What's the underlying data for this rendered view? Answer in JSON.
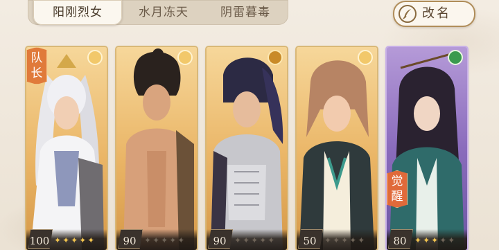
{
  "tabs": [
    {
      "label": "阳刚烈女",
      "active": true
    },
    {
      "label": "水月冻天",
      "active": false
    },
    {
      "label": "阴雷暮毒",
      "active": false
    }
  ],
  "rename_button": {
    "label": "改名",
    "icon": "quill-icon"
  },
  "cards": [
    {
      "name": "card-1",
      "frame": "gold",
      "element_icon": "moon-icon",
      "level": "100",
      "stars_filled": 5,
      "stars_total": 5,
      "captain_tag": "队长",
      "awaken_tag": ""
    },
    {
      "name": "card-2",
      "frame": "gold",
      "element_icon": "moon-icon",
      "level": "90",
      "stars_filled": 0,
      "stars_total": 5,
      "captain_tag": "",
      "awaken_tag": ""
    },
    {
      "name": "card-3",
      "frame": "gold",
      "element_icon": "mountain-icon",
      "level": "90",
      "stars_filled": 0,
      "stars_total": 5,
      "captain_tag": "",
      "awaken_tag": ""
    },
    {
      "name": "card-4",
      "frame": "gold",
      "element_icon": "moon-icon",
      "level": "50",
      "stars_filled": 0,
      "stars_total": 5,
      "captain_tag": "",
      "awaken_tag": ""
    },
    {
      "name": "card-5",
      "frame": "purple",
      "element_icon": "leaf-icon",
      "level": "80",
      "stars_filled": 3,
      "stars_total": 5,
      "captain_tag": "",
      "awaken_tag": "觉醒"
    }
  ]
}
